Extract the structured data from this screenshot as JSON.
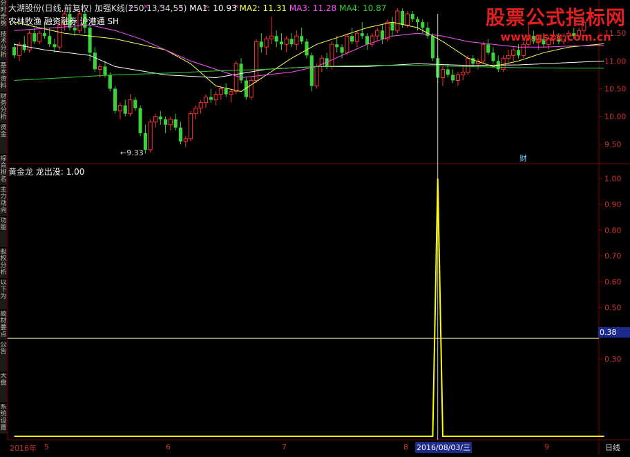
{
  "top_info": {
    "stock": "大湖股份(日线,前复权)",
    "indicator": "加强K线(250,13,34,55)",
    "ma1": "MA1: 10.93",
    "ma2": "MA2: 11.31",
    "ma3": "MA3: 11.28",
    "ma4": "MA4: 10.87",
    "tags": "农林牧渔 融资融券 沪港通 SH",
    "caifu": "财",
    "low_marker": "←9.33"
  },
  "bottom_info": {
    "name": "黄金龙",
    "sig": "龙出没: 1.00"
  },
  "left_tabs": [
    "分时走势",
    "技术分析",
    "基本资料",
    "财务分析",
    "资金",
    "综合排名",
    "主力动向",
    "功能",
    "股权分析",
    "以下为",
    "题材要点",
    "公告",
    "大盘",
    "系统设置"
  ],
  "x_axis": {
    "year": "2016年",
    "months": [
      "5",
      "6",
      "7",
      "8",
      "9"
    ],
    "cursor_date": "2016/08/03/三",
    "period": "日线"
  },
  "right_axis_box": "0.38",
  "watermark": {
    "title": "股票公式指标网",
    "url": "www.gszx.com.cn"
  },
  "colors": {
    "up": "#ff3232",
    "down": "#54fcfc",
    "green": "#3cd23c",
    "ma1": "#ffffff",
    "ma2": "#ffff50",
    "ma3": "#ff50ff",
    "ma4": "#30d030",
    "grid": "#800000",
    "signal": "#ffff00"
  },
  "chart_data": [
    {
      "type": "candlestick",
      "y_ticks": [
        9.5,
        10.0,
        10.5,
        11.0,
        11.5
      ],
      "ylim": [
        9.3,
        11.95
      ],
      "low_label_value": 9.33,
      "candles": [
        [
          11.25,
          11.32,
          11.05,
          11.1
        ],
        [
          11.1,
          11.35,
          11.0,
          11.3
        ],
        [
          11.3,
          11.45,
          11.15,
          11.2
        ],
        [
          11.2,
          11.55,
          11.15,
          11.5
        ],
        [
          11.5,
          11.6,
          11.3,
          11.35
        ],
        [
          11.35,
          11.55,
          11.3,
          11.5
        ],
        [
          11.5,
          11.7,
          11.4,
          11.45
        ],
        [
          11.45,
          11.6,
          11.25,
          11.3
        ],
        [
          11.3,
          11.4,
          11.15,
          11.25
        ],
        [
          11.25,
          11.7,
          11.2,
          11.65
        ],
        [
          11.65,
          11.9,
          11.55,
          11.85
        ],
        [
          11.85,
          11.92,
          11.55,
          11.6
        ],
        [
          11.6,
          11.7,
          11.45,
          11.55
        ],
        [
          11.55,
          11.95,
          11.5,
          11.85
        ],
        [
          11.85,
          11.9,
          11.5,
          11.6
        ],
        [
          11.6,
          11.65,
          11.0,
          11.15
        ],
        [
          11.15,
          11.25,
          10.8,
          10.85
        ],
        [
          10.85,
          10.95,
          10.7,
          10.9
        ],
        [
          10.9,
          11.0,
          10.7,
          10.75
        ],
        [
          10.75,
          10.8,
          10.45,
          10.5
        ],
        [
          10.5,
          10.55,
          10.05,
          10.1
        ],
        [
          10.1,
          10.25,
          9.95,
          10.2
        ],
        [
          10.2,
          10.3,
          10.0,
          10.05
        ],
        [
          10.05,
          10.4,
          10.0,
          10.3
        ],
        [
          10.3,
          10.35,
          10.1,
          10.15
        ],
        [
          10.15,
          10.2,
          9.65,
          9.7
        ],
        [
          9.7,
          9.85,
          9.33,
          9.4
        ],
        [
          9.4,
          9.95,
          9.35,
          9.9
        ],
        [
          9.9,
          10.05,
          9.8,
          10.0
        ],
        [
          10.0,
          10.1,
          9.85,
          9.95
        ],
        [
          9.95,
          10.0,
          9.7,
          9.85
        ],
        [
          9.85,
          10.0,
          9.75,
          9.95
        ],
        [
          9.95,
          10.05,
          9.75,
          9.8
        ],
        [
          9.8,
          9.9,
          9.5,
          9.55
        ],
        [
          9.55,
          9.65,
          9.45,
          9.6
        ],
        [
          9.6,
          10.1,
          9.55,
          10.05
        ],
        [
          10.05,
          10.2,
          9.95,
          10.15
        ],
        [
          10.15,
          10.3,
          10.05,
          10.25
        ],
        [
          10.25,
          10.4,
          10.15,
          10.35
        ],
        [
          10.35,
          10.5,
          10.25,
          10.3
        ],
        [
          10.3,
          10.45,
          10.2,
          10.4
        ],
        [
          10.4,
          10.55,
          10.3,
          10.5
        ],
        [
          10.5,
          10.6,
          10.35,
          10.4
        ],
        [
          10.4,
          10.5,
          10.25,
          10.45
        ],
        [
          10.45,
          11.0,
          10.4,
          10.95
        ],
        [
          10.95,
          11.05,
          10.6,
          10.65
        ],
        [
          10.65,
          10.7,
          10.3,
          10.35
        ],
        [
          10.35,
          10.7,
          10.3,
          10.65
        ],
        [
          10.65,
          11.4,
          10.6,
          11.35
        ],
        [
          11.35,
          11.5,
          11.15,
          11.25
        ],
        [
          11.25,
          11.45,
          11.1,
          11.4
        ],
        [
          11.4,
          11.8,
          11.3,
          11.45
        ],
        [
          11.45,
          11.55,
          11.25,
          11.35
        ],
        [
          11.35,
          11.5,
          11.2,
          11.3
        ],
        [
          11.3,
          11.45,
          11.15,
          11.4
        ],
        [
          11.4,
          11.5,
          11.25,
          11.3
        ],
        [
          11.3,
          11.55,
          11.2,
          11.45
        ],
        [
          11.45,
          11.6,
          11.3,
          11.35
        ],
        [
          11.35,
          11.4,
          11.05,
          11.1
        ],
        [
          11.1,
          11.15,
          10.45,
          10.55
        ],
        [
          10.55,
          10.95,
          10.5,
          10.9
        ],
        [
          10.9,
          11.1,
          10.8,
          11.05
        ],
        [
          11.05,
          11.15,
          10.85,
          10.9
        ],
        [
          10.9,
          11.35,
          10.85,
          11.3
        ],
        [
          11.3,
          11.45,
          11.15,
          11.25
        ],
        [
          11.25,
          11.3,
          11.05,
          11.15
        ],
        [
          11.15,
          11.5,
          11.1,
          11.45
        ],
        [
          11.45,
          11.6,
          11.3,
          11.35
        ],
        [
          11.35,
          11.55,
          11.25,
          11.5
        ],
        [
          11.5,
          11.7,
          11.4,
          11.45
        ],
        [
          11.45,
          11.5,
          11.2,
          11.3
        ],
        [
          11.3,
          11.5,
          11.25,
          11.45
        ],
        [
          11.45,
          11.6,
          11.35,
          11.55
        ],
        [
          11.55,
          11.65,
          11.3,
          11.4
        ],
        [
          11.4,
          11.75,
          11.35,
          11.7
        ],
        [
          11.7,
          11.8,
          11.45,
          11.55
        ],
        [
          11.55,
          11.95,
          11.5,
          11.9
        ],
        [
          11.9,
          11.95,
          11.6,
          11.65
        ],
        [
          11.65,
          11.9,
          11.6,
          11.85
        ],
        [
          11.85,
          11.9,
          11.7,
          11.75
        ],
        [
          11.75,
          11.8,
          11.55,
          11.7
        ],
        [
          11.7,
          11.75,
          11.5,
          11.6
        ],
        [
          11.6,
          11.7,
          11.4,
          11.45
        ],
        [
          11.45,
          11.5,
          11.0,
          11.05
        ],
        [
          11.05,
          11.1,
          10.6,
          10.7
        ],
        [
          10.7,
          10.9,
          10.55,
          10.85
        ],
        [
          10.85,
          10.95,
          10.7,
          10.75
        ],
        [
          10.75,
          10.85,
          10.6,
          10.65
        ],
        [
          10.65,
          10.8,
          10.55,
          10.75
        ],
        [
          10.75,
          10.9,
          10.65,
          10.8
        ],
        [
          10.8,
          11.1,
          10.75,
          11.05
        ],
        [
          11.05,
          11.1,
          10.9,
          10.95
        ],
        [
          10.95,
          11.05,
          10.85,
          11.0
        ],
        [
          11.0,
          11.35,
          10.95,
          11.3
        ],
        [
          11.3,
          11.4,
          11.1,
          11.15
        ],
        [
          11.15,
          11.25,
          10.95,
          11.0
        ],
        [
          11.0,
          11.1,
          10.8,
          10.85
        ],
        [
          10.85,
          11.1,
          10.8,
          11.05
        ],
        [
          11.05,
          11.2,
          10.95,
          11.1
        ],
        [
          11.1,
          11.25,
          11.0,
          11.2
        ],
        [
          11.2,
          11.3,
          11.05,
          11.1
        ],
        [
          11.1,
          11.35,
          11.05,
          11.3
        ],
        [
          11.3,
          11.7,
          11.25,
          11.45
        ],
        [
          11.45,
          11.55,
          11.3,
          11.35
        ],
        [
          11.35,
          11.45,
          11.2,
          11.4
        ],
        [
          11.4,
          11.5,
          11.25,
          11.3
        ],
        [
          11.3,
          11.45,
          11.2,
          11.4
        ],
        [
          11.4,
          11.55,
          11.3,
          11.45
        ],
        [
          11.45,
          11.5,
          11.3,
          11.35
        ],
        [
          11.35,
          11.5,
          11.3,
          11.45
        ],
        [
          11.45,
          11.55,
          11.35,
          11.5
        ],
        [
          11.5,
          11.6,
          11.4,
          11.45
        ],
        [
          11.45,
          11.6,
          11.4,
          11.55
        ],
        [
          11.55,
          11.75,
          11.5,
          11.7
        ]
      ],
      "ma": {
        "MA1": [
          [
            0,
            11.3
          ],
          [
            6,
            11.2
          ],
          [
            15,
            11.1
          ],
          [
            20,
            10.9
          ],
          [
            30,
            10.75
          ],
          [
            40,
            10.7
          ],
          [
            50,
            10.85
          ],
          [
            60,
            10.9
          ],
          [
            70,
            10.9
          ],
          [
            80,
            10.95
          ],
          [
            90,
            10.92
          ],
          [
            100,
            10.93
          ],
          [
            117,
            11.0
          ]
        ],
        "MA2": [
          [
            0,
            11.7
          ],
          [
            5,
            11.6
          ],
          [
            10,
            11.5
          ],
          [
            15,
            11.45
          ],
          [
            20,
            11.4
          ],
          [
            25,
            11.3
          ],
          [
            30,
            11.2
          ],
          [
            35,
            10.95
          ],
          [
            40,
            10.55
          ],
          [
            45,
            10.45
          ],
          [
            50,
            10.75
          ],
          [
            55,
            11.05
          ],
          [
            60,
            11.3
          ],
          [
            65,
            11.45
          ],
          [
            70,
            11.6
          ],
          [
            75,
            11.7
          ],
          [
            80,
            11.6
          ],
          [
            85,
            11.35
          ],
          [
            90,
            11.05
          ],
          [
            95,
            10.9
          ],
          [
            100,
            11.0
          ],
          [
            105,
            11.15
          ],
          [
            110,
            11.25
          ],
          [
            117,
            11.31
          ]
        ],
        "MA3": [
          [
            0,
            11.55
          ],
          [
            8,
            11.6
          ],
          [
            15,
            11.65
          ],
          [
            20,
            11.55
          ],
          [
            25,
            11.4
          ],
          [
            30,
            11.2
          ],
          [
            35,
            11.0
          ],
          [
            40,
            10.85
          ],
          [
            45,
            10.7
          ],
          [
            50,
            10.75
          ],
          [
            55,
            10.8
          ],
          [
            60,
            10.9
          ],
          [
            65,
            11.1
          ],
          [
            70,
            11.3
          ],
          [
            75,
            11.45
          ],
          [
            80,
            11.5
          ],
          [
            85,
            11.45
          ],
          [
            90,
            11.35
          ],
          [
            95,
            11.3
          ],
          [
            100,
            11.25
          ],
          [
            105,
            11.25
          ],
          [
            110,
            11.27
          ],
          [
            117,
            11.28
          ]
        ],
        "MA4": [
          [
            0,
            10.65
          ],
          [
            10,
            10.7
          ],
          [
            20,
            10.75
          ],
          [
            30,
            10.78
          ],
          [
            40,
            10.82
          ],
          [
            50,
            10.85
          ],
          [
            60,
            10.9
          ],
          [
            70,
            10.92
          ],
          [
            80,
            10.92
          ],
          [
            90,
            10.9
          ],
          [
            100,
            10.88
          ],
          [
            110,
            10.87
          ],
          [
            117,
            10.87
          ]
        ]
      }
    },
    {
      "type": "line",
      "name": "龙出没",
      "y_ticks": [
        0.3,
        0.4,
        0.5,
        0.6,
        0.7,
        0.8,
        0.9,
        1.0
      ],
      "ylim": [
        0,
        1.05
      ],
      "signal_index": 84,
      "points": [
        [
          0,
          0
        ],
        [
          83,
          0
        ],
        [
          84,
          1.0
        ],
        [
          85,
          0
        ],
        [
          117,
          0
        ]
      ],
      "hline": 0.38
    }
  ]
}
